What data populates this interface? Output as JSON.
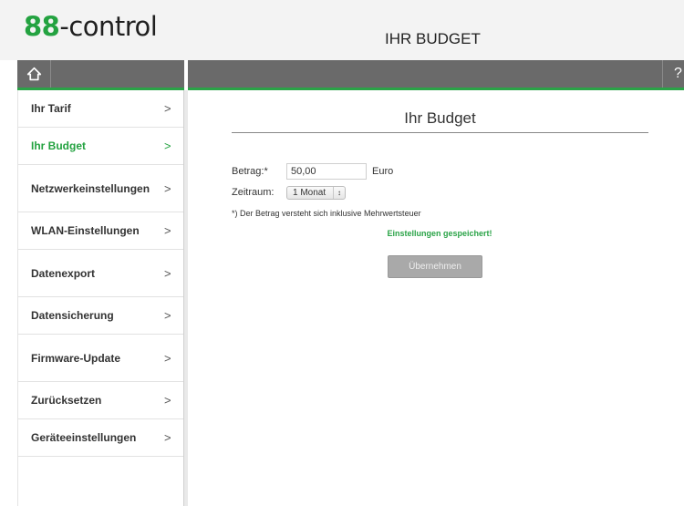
{
  "header": {
    "logo_prefix": "88",
    "logo_text": "-control",
    "title": "IHR BUDGET"
  },
  "topbar": {
    "home_icon": "home-icon",
    "help_label": "?"
  },
  "sidebar": {
    "items": [
      {
        "label": "Ihr Tarif",
        "active": false
      },
      {
        "label": "Ihr Budget",
        "active": true
      },
      {
        "label": "Netzwerkeinstellungen",
        "active": false
      },
      {
        "label": "WLAN-Einstellungen",
        "active": false
      },
      {
        "label": "Datenexport",
        "active": false
      },
      {
        "label": "Datensicherung",
        "active": false
      },
      {
        "label": "Firmware-Update",
        "active": false
      },
      {
        "label": "Zurücksetzen",
        "active": false
      },
      {
        "label": "Geräteeinstellungen",
        "active": false
      }
    ],
    "chevron": ">"
  },
  "main": {
    "title": "Ihr Budget",
    "amount_label": "Betrag:*",
    "amount_value": "50,00",
    "amount_unit": "Euro",
    "period_label": "Zeitraum:",
    "period_value": "1 Monat",
    "note": "*) Der Betrag versteht sich inklusive Mehrwertsteuer",
    "saved_message": "Einstellungen gespeichert!",
    "apply_button": "Übernehmen"
  },
  "colors": {
    "accent": "#2aa347",
    "bar": "#6a6a6a"
  }
}
